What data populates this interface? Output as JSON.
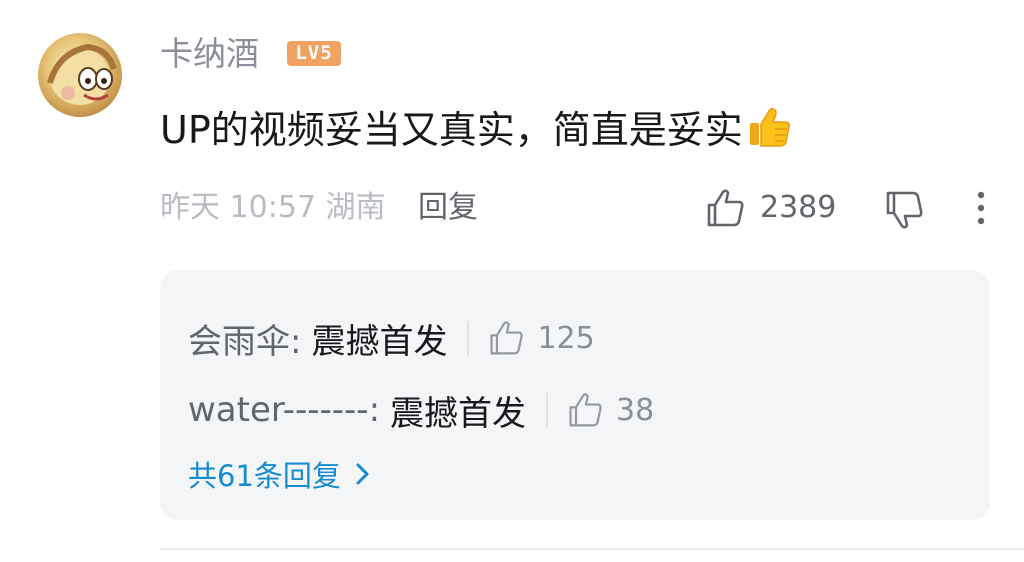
{
  "comment": {
    "username": "卡纳酒",
    "level_badge": "LV5",
    "text": "UP的视频妥当又真实，简直是妥实",
    "emoji": "thumbs-up-emoji",
    "time_location": "昨天 10:57 湖南",
    "reply_label": "回复",
    "like_count": "2389"
  },
  "replies": [
    {
      "author": "会雨伞:",
      "text": "震撼首发",
      "likes": "125"
    },
    {
      "author": "water-------:",
      "text": "震撼首发",
      "likes": "38"
    }
  ],
  "view_replies_label": "共61条回复",
  "colors": {
    "link_blue": "#178bcf",
    "badge_orange": "#f0a262",
    "text_dark": "#18191c",
    "text_gray": "#8a8f99",
    "reply_bg": "#f4f5f7"
  }
}
